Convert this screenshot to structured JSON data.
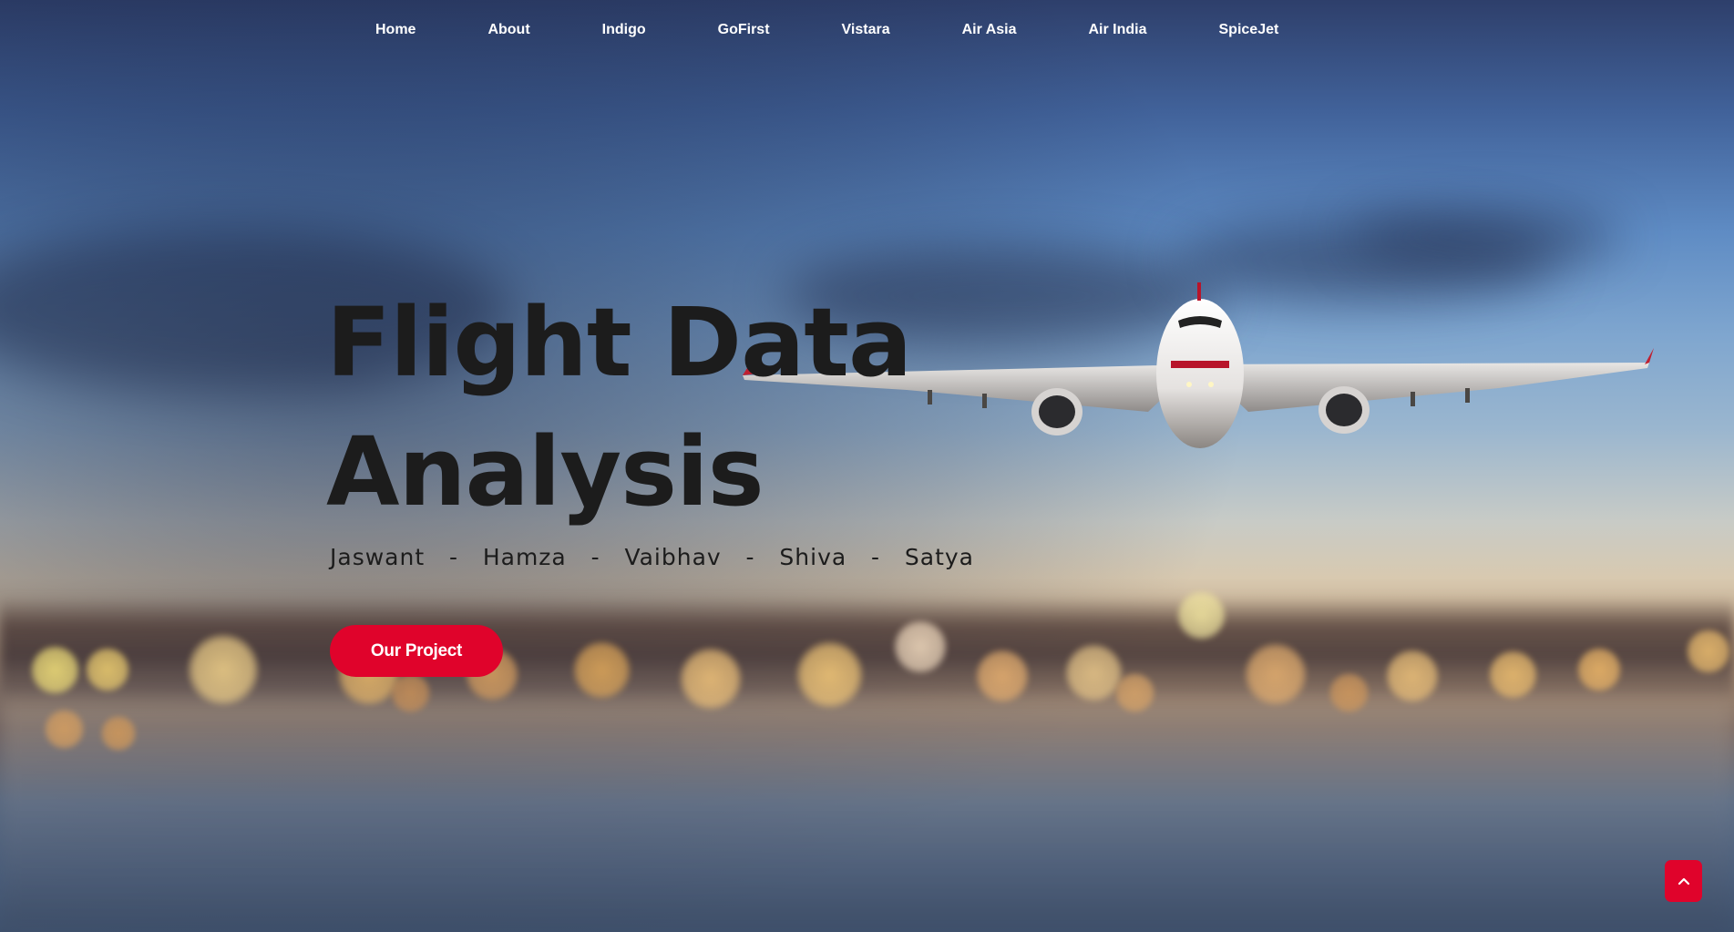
{
  "nav": {
    "items": [
      {
        "label": "Home"
      },
      {
        "label": "About"
      },
      {
        "label": "Indigo"
      },
      {
        "label": "GoFirst"
      },
      {
        "label": "Vistara"
      },
      {
        "label": "Air Asia"
      },
      {
        "label": "Air India"
      },
      {
        "label": "SpiceJet"
      }
    ]
  },
  "hero": {
    "title_line1": "Flight Data",
    "title_line2": "Analysis",
    "names": "Jaswant   -   Hamza   -   Vaibhav   -   Shiva   -   Satya",
    "cta_label": "Our Project"
  },
  "scroll_top": {
    "icon": "chevron-up-icon"
  },
  "background": {
    "description_icon": "airplane-icon"
  },
  "colors": {
    "accent": "#e0032b",
    "title_text": "#1c1c1c",
    "nav_text": "#ffffff"
  }
}
